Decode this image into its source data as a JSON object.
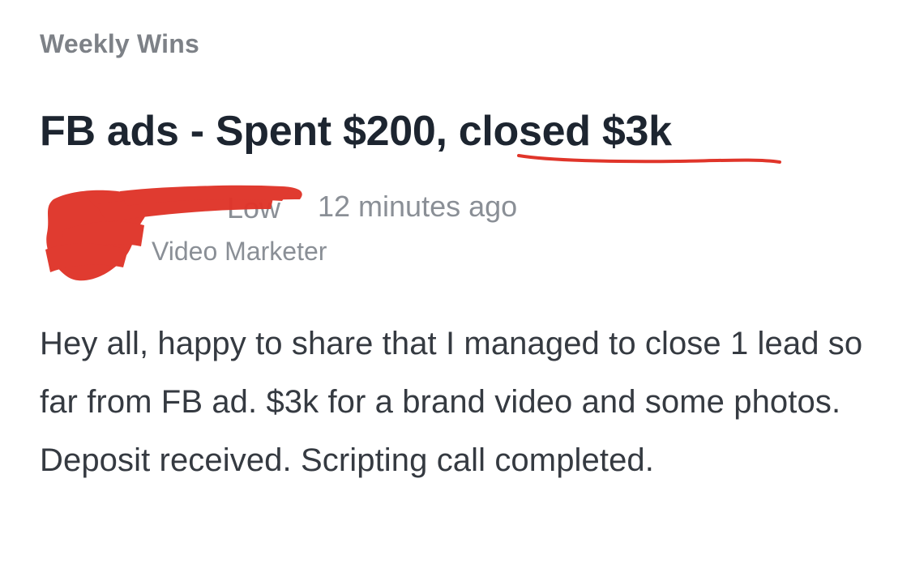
{
  "post": {
    "category": "Weekly Wins",
    "title_part1": "FB ads - Spent $200,",
    "title_part2": "closed $3k",
    "author": {
      "name_fragment": "Low",
      "timestamp": "12 minutes ago",
      "role": "Video Marketer"
    },
    "body": "Hey all, happy to share that I managed to close 1 lead so far from FB ad. $3k for a brand video and some photos. Deposit received. Scripting call completed.",
    "annotation_color": "#e0352a"
  }
}
